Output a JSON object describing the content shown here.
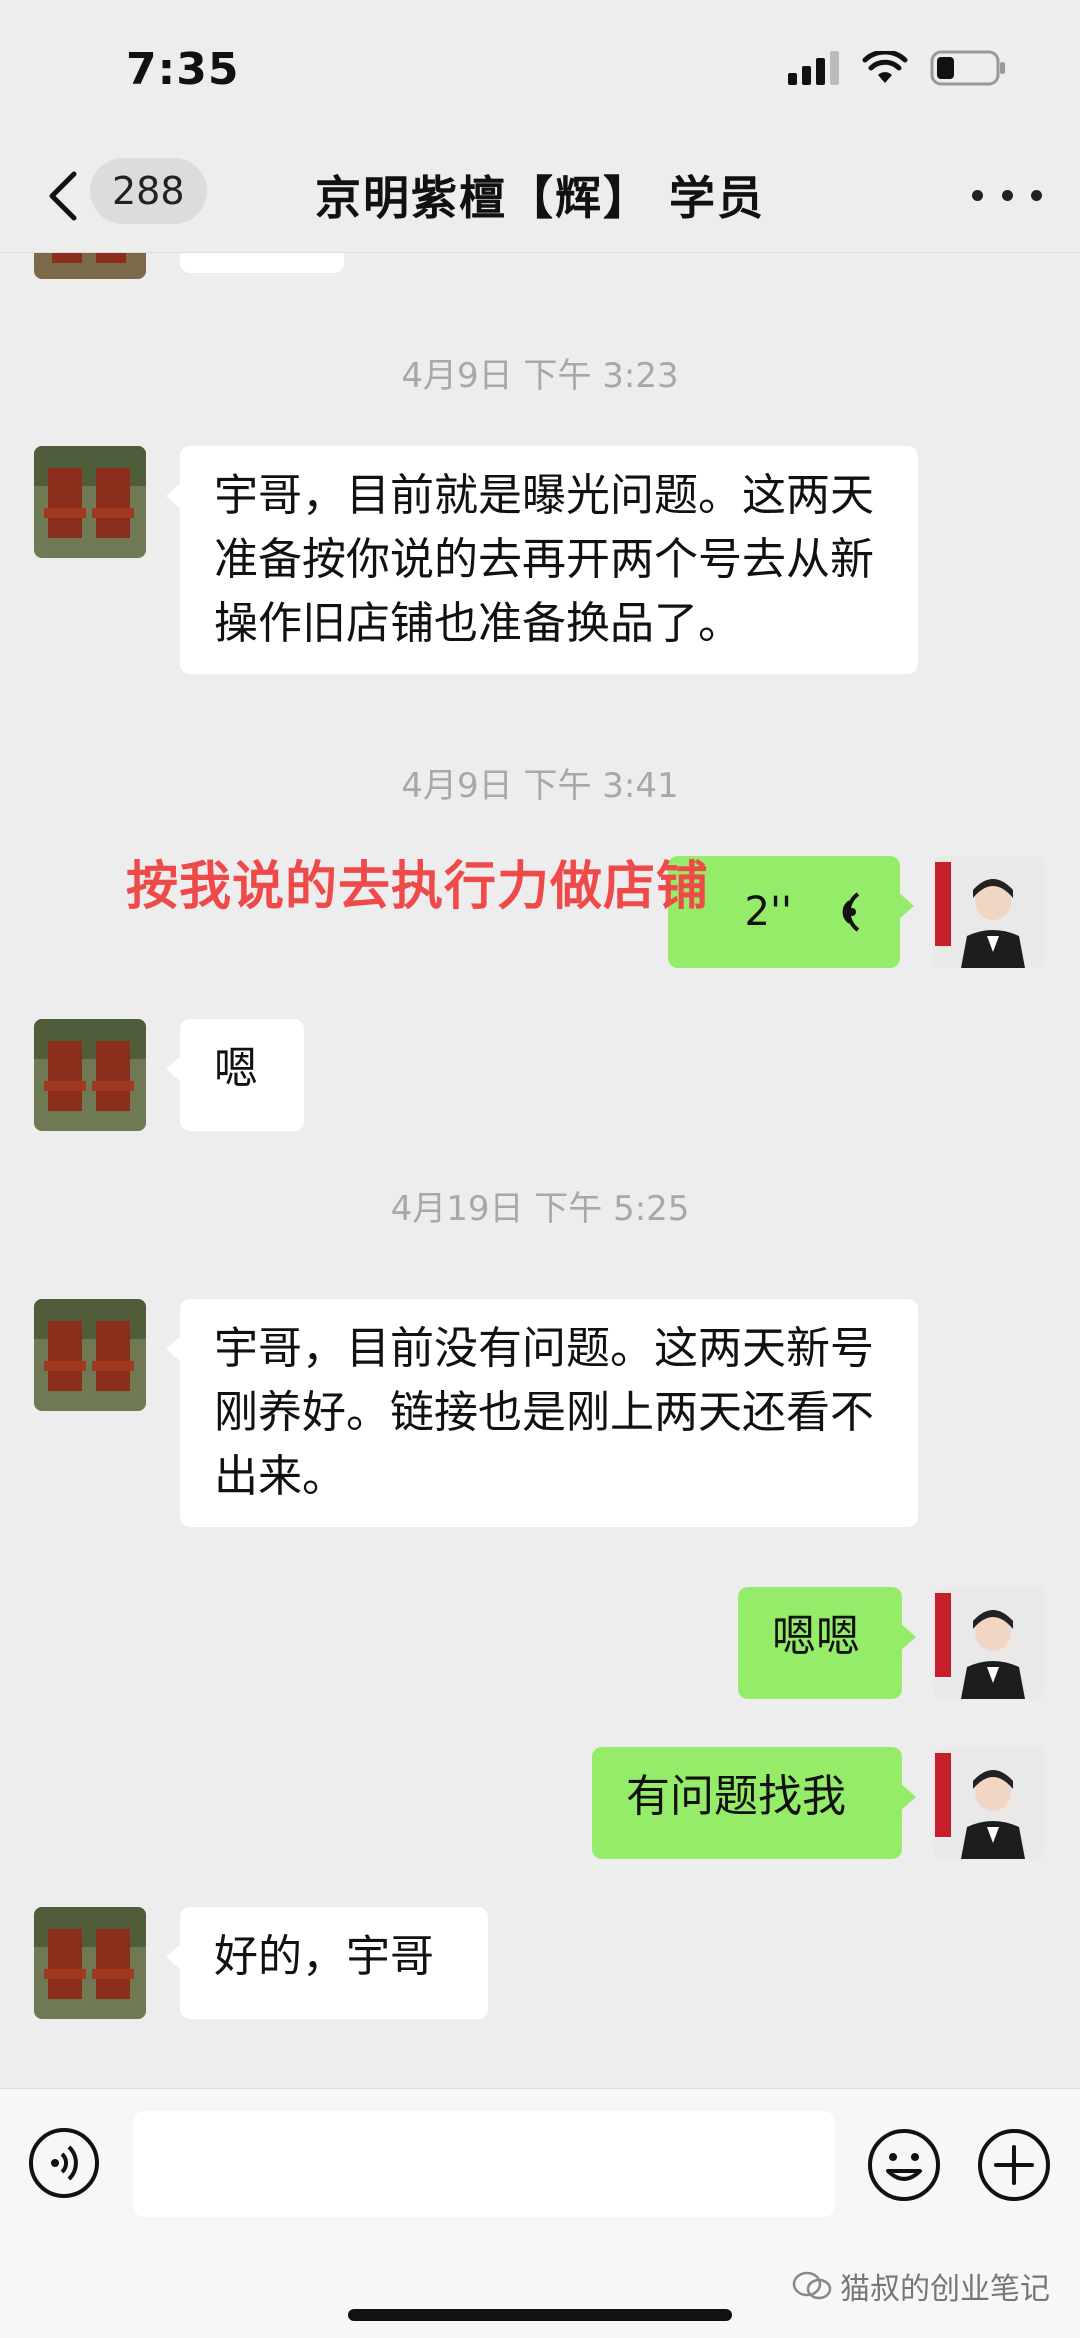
{
  "status_bar": {
    "time": "7:35",
    "battery_percent": 30
  },
  "nav": {
    "unread_count": "288",
    "title": "京明紫檀【辉】 学员",
    "more_icon": "more-horizontal-icon",
    "back_icon": "chevron-left-icon"
  },
  "messages": {
    "ts1": "4月9日 下午 3:23",
    "m1": "宇哥，目前就是曝光问题。这两天准备按你说的去再开两个号去从新操作旧店铺也准备换品了。",
    "ts2": "4月9日 下午 3:41",
    "voice_duration": "2''",
    "m3": "嗯",
    "ts3": "4月19日 下午 5:25",
    "m4": "宇哥，目前没有问题。这两天新号刚养好。链接也是刚上两天还看不出来。",
    "m5": "嗯嗯",
    "m6": "有问题找我",
    "m7": "好的，宇哥"
  },
  "annotation": "按我说的去执行力做店铺",
  "input": {
    "placeholder": ""
  },
  "watermark": "猫叔的创业笔记",
  "colors": {
    "background": "#ededed",
    "sent_bubble": "#95ec69",
    "received_bubble": "#ffffff",
    "annotation": "#ee4a4a"
  }
}
